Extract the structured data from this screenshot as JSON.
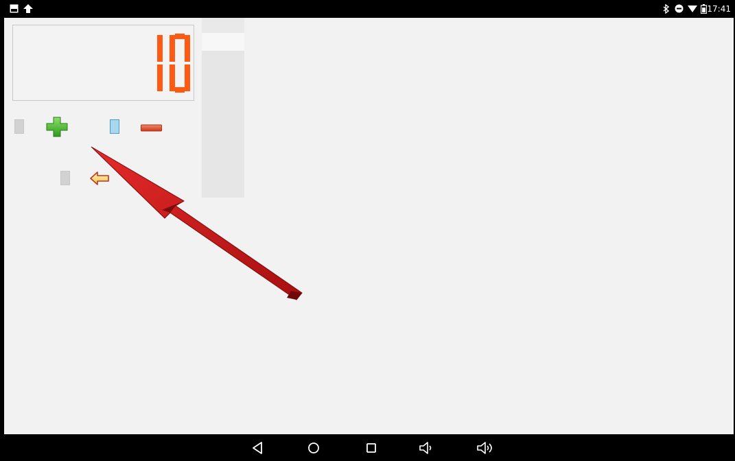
{
  "status_bar": {
    "left_icons": [
      "image-icon",
      "upload-icon"
    ],
    "right_icons": [
      "bluetooth-icon",
      "do-not-disturb-icon",
      "wifi-icon",
      "battery-icon"
    ],
    "time": "17:41"
  },
  "counter": {
    "value": "10",
    "color": "#ff5a14"
  },
  "controls": {
    "increment_icon": "plus-icon",
    "decrement_icon": "minus-icon",
    "back_icon": "back-arrow-icon",
    "increment_checked": false,
    "decrement_checked": true,
    "back_checked": false
  },
  "annotation": {
    "arrow_color": "#c41616"
  },
  "nav_bar": {
    "buttons": [
      "back-nav-icon",
      "home-nav-icon",
      "recents-nav-icon",
      "volume-down-icon",
      "volume-up-icon"
    ]
  }
}
